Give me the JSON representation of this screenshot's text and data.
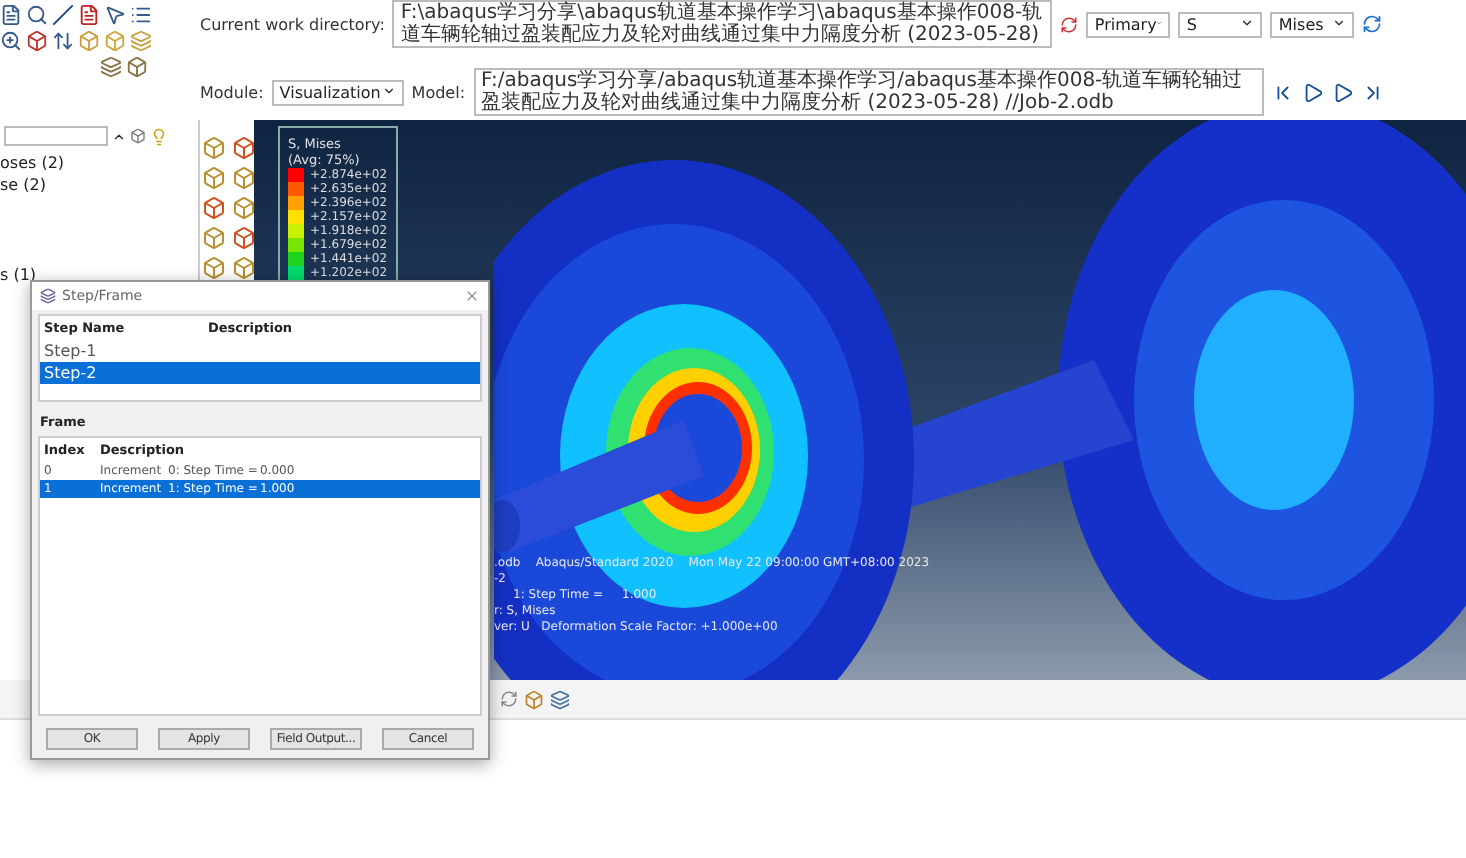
{
  "work_directory": {
    "label": "Current work directory:",
    "value": "F:\\abaqus学习分享\\abaqus轨道基本操作学习\\abaqus基本操作008-轨道车辆轮轴过盈装配应力及轮对曲线通过集中力隔度分析 (2023-05-28)"
  },
  "selectors": [
    "Primary",
    "S",
    "Mises"
  ],
  "module": {
    "label": "Module:",
    "value": "Visualization"
  },
  "model": {
    "label": "Model:",
    "value": "F:/abaqus学习分享/abaqus轨道基本操作学习/abaqus基本操作008-轨道车辆轮轴过盈装配应力及轮对曲线通过集中力隔度分析 (2023-05-28) //Job-2.odb"
  },
  "tree": {
    "items": [
      "oses (2)",
      "se (2)",
      "s (1)"
    ]
  },
  "legend": {
    "title": "S, Mises",
    "subtitle": "(Avg: 75%)",
    "entries": [
      {
        "value": "+2.874e+02",
        "color": "#ff0000"
      },
      {
        "value": "+2.635e+02",
        "color": "#ff5a00"
      },
      {
        "value": "+2.396e+02",
        "color": "#ffa000"
      },
      {
        "value": "+2.157e+02",
        "color": "#ffe000"
      },
      {
        "value": "+1.918e+02",
        "color": "#c8f000"
      },
      {
        "value": "+1.679e+02",
        "color": "#78e600"
      },
      {
        "value": "+1.441e+02",
        "color": "#1ed21e"
      },
      {
        "value": "+1.202e+02",
        "color": "#00dc6e"
      }
    ]
  },
  "viewport_info": [
    ".odb    Abaqus/Standard 2020    Mon May 22 09:00:00 GMT+08:00 2023",
    "-2",
    "     1: Step Time =     1.000",
    "r: S, Mises",
    "ver: U   Deformation Scale Factor: +1.000e+00"
  ],
  "dialog": {
    "title": "Step/Frame",
    "step_columns": [
      "Step Name",
      "Description"
    ],
    "steps": [
      {
        "name": "Step-1",
        "selected": false
      },
      {
        "name": "Step-2",
        "selected": true
      }
    ],
    "frame_label": "Frame",
    "frame_columns": [
      "Index",
      "Description"
    ],
    "frames": [
      {
        "index": "0",
        "kind": "Increment",
        "time": "0: Step Time =",
        "value": "0.000",
        "selected": false
      },
      {
        "index": "1",
        "kind": "Increment",
        "time": "1: Step Time =",
        "value": "1.000",
        "selected": true
      }
    ],
    "buttons": [
      "OK",
      "Apply",
      "Field Output...",
      "Cancel"
    ]
  }
}
